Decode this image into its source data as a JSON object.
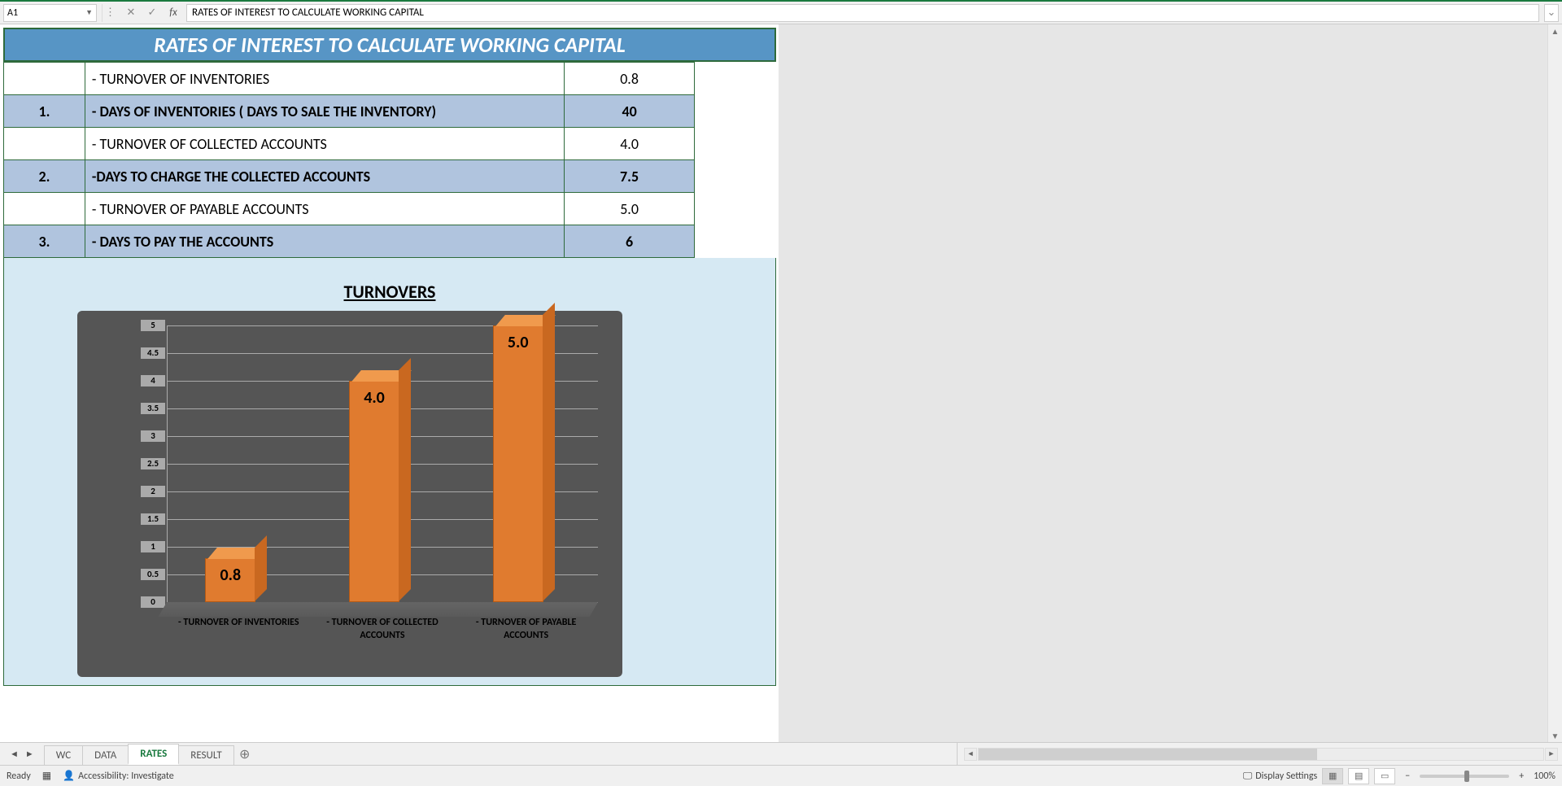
{
  "formula_bar": {
    "cell_ref": "A1",
    "formula": "RATES OF INTEREST TO CALCULATE WORKING CAPITAL"
  },
  "title": "RATES OF INTEREST TO CALCULATE WORKING CAPITAL",
  "rows": [
    {
      "num": "",
      "label": "- TURNOVER OF INVENTORIES",
      "value": "0.8",
      "bold": false
    },
    {
      "num": "1.",
      "label": "- DAYS OF INVENTORIES ( DAYS TO SALE THE INVENTORY)",
      "value": "40",
      "bold": true
    },
    {
      "num": "",
      "label": "- TURNOVER OF COLLECTED ACCOUNTS",
      "value": "4.0",
      "bold": false
    },
    {
      "num": "2.",
      "label": "-DAYS TO CHARGE THE COLLECTED ACCOUNTS",
      "value": "7.5",
      "bold": true
    },
    {
      "num": "",
      "label": "- TURNOVER OF PAYABLE ACCOUNTS",
      "value": "5.0",
      "bold": false
    },
    {
      "num": "3.",
      "label": "- DAYS TO PAY THE ACCOUNTS",
      "value": "6",
      "bold": true
    }
  ],
  "chart_title": "TURNOVERS",
  "chart_data": {
    "type": "bar",
    "title": "TURNOVERS",
    "categories": [
      "- TURNOVER OF INVENTORIES",
      "- TURNOVER OF COLLECTED ACCOUNTS",
      "- TURNOVER OF PAYABLE ACCOUNTS"
    ],
    "values": [
      0.8,
      4.0,
      5.0
    ],
    "value_labels": [
      "0.8",
      "4.0",
      "5.0"
    ],
    "ylim": [
      0,
      5
    ],
    "yticks": [
      0,
      0.5,
      1,
      1.5,
      2,
      2.5,
      3,
      3.5,
      4,
      4.5,
      5
    ],
    "ytick_labels": [
      "0",
      "0.5",
      "1",
      "1.5",
      "2",
      "2.5",
      "3",
      "3.5",
      "4",
      "4.5",
      "5"
    ],
    "xlabel": "",
    "ylabel": ""
  },
  "sheet_tabs": {
    "tabs": [
      "WC",
      "DATA",
      "RATES",
      "RESULT"
    ],
    "active": "RATES"
  },
  "status_bar": {
    "ready": "Ready",
    "accessibility": "Accessibility: Investigate",
    "display_settings": "Display Settings",
    "zoom": "100%"
  }
}
